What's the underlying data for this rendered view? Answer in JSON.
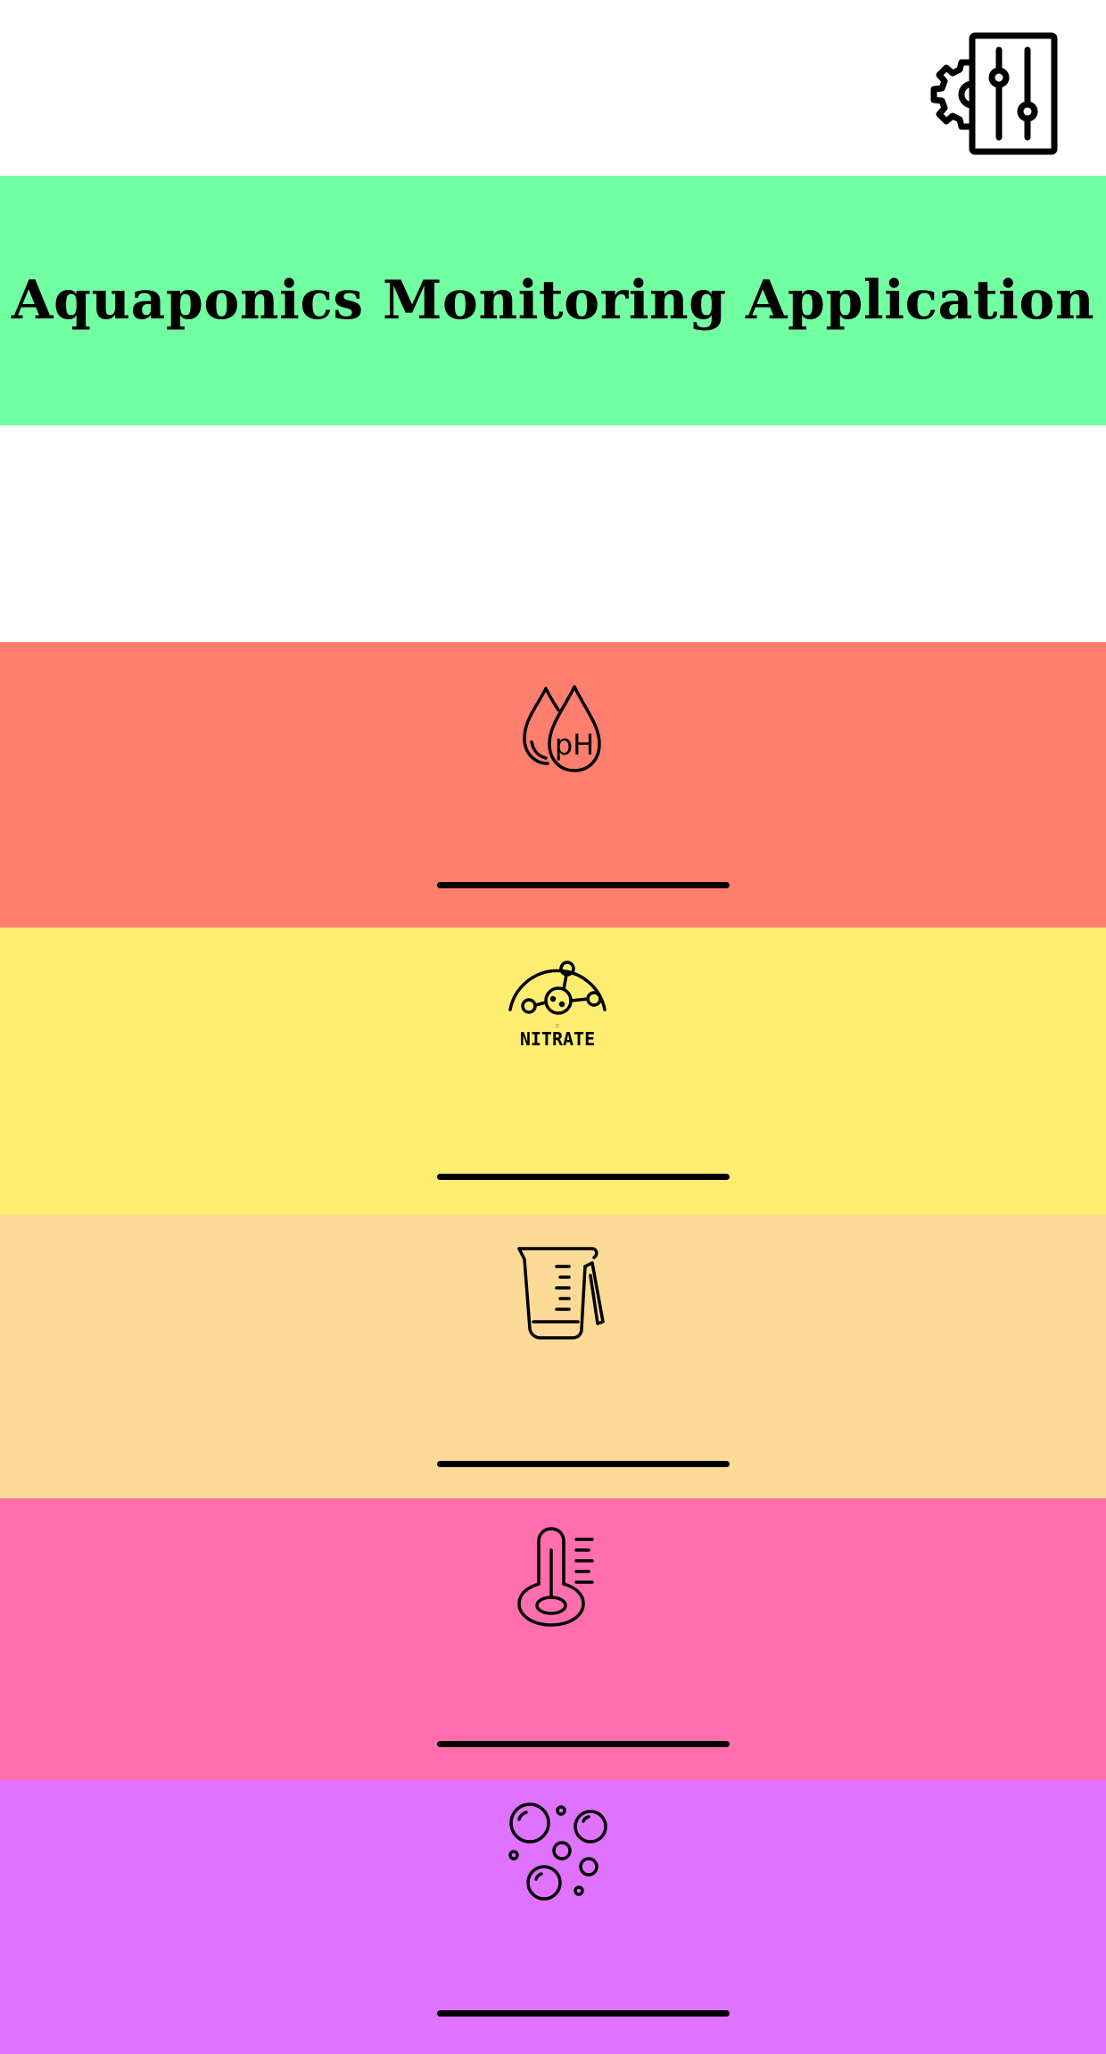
{
  "app": {
    "title": "Aquaponics Monitoring Application"
  },
  "toolbar": {
    "settings_icon": "settings-sliders-gear-icon"
  },
  "colors": {
    "header": "#72ffa1",
    "ph": "#ff7f6e",
    "nitrate": "#feed71",
    "water_level": "#fcdb97",
    "temperature": "#ff6fae",
    "dissolved_oxygen": "#df72ff"
  },
  "sensors": [
    {
      "id": "ph",
      "icon": "ph-drops-icon",
      "icon_text": "pH",
      "value": ""
    },
    {
      "id": "nitrate",
      "icon": "nitrate-molecule-icon",
      "icon_text": "NITRATE",
      "value": ""
    },
    {
      "id": "water-level",
      "icon": "measuring-cup-icon",
      "value": ""
    },
    {
      "id": "temperature",
      "icon": "thermometer-icon",
      "value": ""
    },
    {
      "id": "dissolved-oxygen",
      "icon": "bubbles-icon",
      "value": ""
    }
  ]
}
